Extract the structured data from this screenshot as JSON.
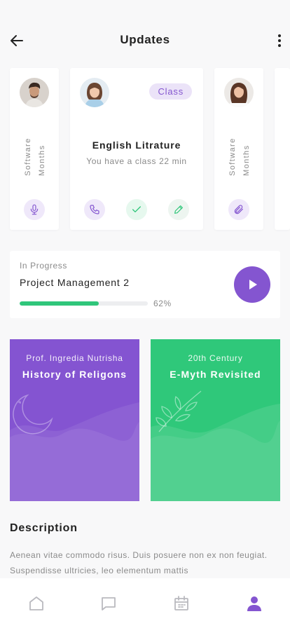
{
  "header": {
    "title": "Updates",
    "back_icon": "arrow-left-icon",
    "more_icon": "more-vertical-icon"
  },
  "cards": [
    {
      "type": "narrow",
      "labels": [
        "Software",
        "Months"
      ],
      "action_icon": "microphone-icon"
    },
    {
      "type": "wide",
      "badge": "Class",
      "title": "English Litrature",
      "subtitle": "You have a class 22 min",
      "actions": [
        "phone-icon",
        "check-icon",
        "pencil-icon"
      ]
    },
    {
      "type": "narrow",
      "labels": [
        "Software",
        "Months"
      ],
      "action_icon": "paperclip-icon"
    }
  ],
  "progress": {
    "status": "In Progress",
    "title": "Project Management 2",
    "percent_label": "62%",
    "percent": 0.62,
    "play_icon": "play-icon"
  },
  "courses": [
    {
      "subtitle": "Prof. Ingredia Nutrisha",
      "title": "History of Religons",
      "color": "#8454d1",
      "icon": "moon-icon"
    },
    {
      "subtitle": "20th Century",
      "title": "E-Myth Revisited",
      "color": "#2fc87a",
      "icon": "leaf-icon"
    }
  ],
  "description": {
    "title": "Description",
    "text": "Aenean vitae commodo risus. Duis posuere non ex non feugiat. Suspendisse ultricies, leo elementum mattis"
  },
  "nav": [
    {
      "name": "home",
      "icon": "home-icon",
      "active": false
    },
    {
      "name": "chat",
      "icon": "chat-icon",
      "active": false
    },
    {
      "name": "calendar",
      "icon": "calendar-icon",
      "active": false
    },
    {
      "name": "profile",
      "icon": "profile-icon",
      "active": true
    }
  ],
  "colors": {
    "accent": "#8455d0",
    "green": "#2fc67a",
    "muted": "#8a8a8a"
  }
}
